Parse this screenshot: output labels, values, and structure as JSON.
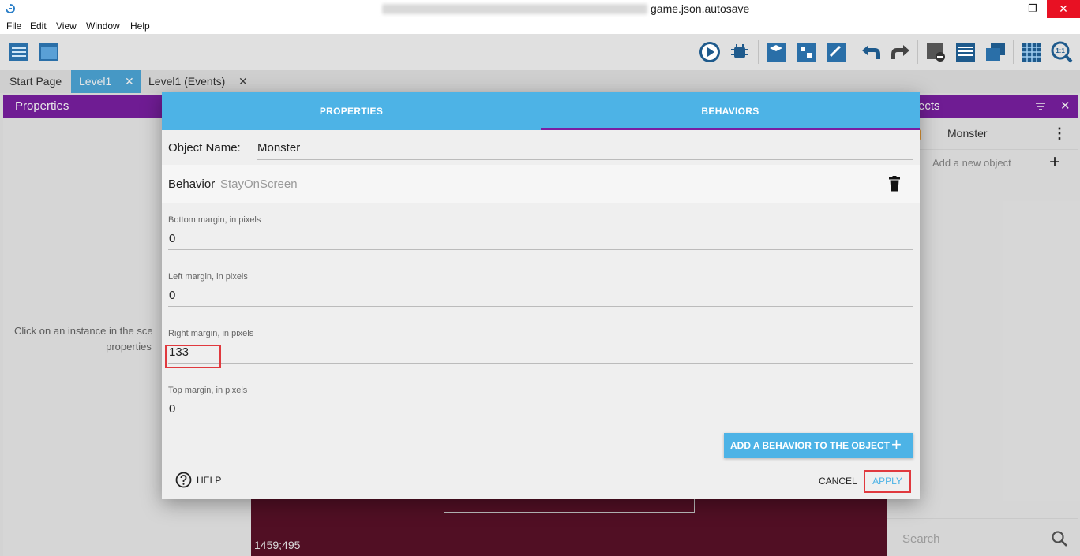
{
  "window": {
    "title": "game.json.autosave",
    "minimize": "—",
    "maximize": "❐",
    "close": "✕"
  },
  "menu": [
    "File",
    "Edit",
    "View",
    "Window",
    "Help"
  ],
  "tabs": [
    {
      "label": "Start Page",
      "active": false,
      "closable": false
    },
    {
      "label": "Level1",
      "active": true,
      "closable": true
    },
    {
      "label": "Level1 (Events)",
      "active": false,
      "closable": true
    }
  ],
  "tab_close_glyph": "✕",
  "properties_panel": {
    "title": "Properties",
    "hint_line1": "Click on an instance in the sce",
    "hint_line2": "properties"
  },
  "scene": {
    "coordinates": "1459;495"
  },
  "objects_panel": {
    "title": "ects",
    "close": "✕",
    "objects": [
      {
        "name": "Monster",
        "menu": "⋮"
      }
    ],
    "add_label": "Add a new object",
    "add_glyph": "+",
    "search_placeholder": "Search"
  },
  "dialog": {
    "tabs": {
      "properties": "PROPERTIES",
      "behaviors": "BEHAVIORS",
      "active": "behaviors"
    },
    "object_name_label": "Object Name:",
    "object_name_value": "Monster",
    "behavior_label": "Behavior",
    "behavior_name": "StayOnScreen",
    "fields": [
      {
        "label": "Bottom margin, in pixels",
        "value": "0"
      },
      {
        "label": "Left margin, in pixels",
        "value": "0"
      },
      {
        "label": "Right margin, in pixels",
        "value": "133"
      },
      {
        "label": "Top margin, in pixels",
        "value": "0"
      }
    ],
    "add_behavior_label": "ADD A BEHAVIOR TO THE OBJECT",
    "add_behavior_glyph": "+",
    "help_label": "HELP",
    "cancel_label": "CANCEL",
    "apply_label": "APPLY"
  },
  "colors": {
    "accent_blue": "#4db3e6",
    "panel_purple": "#7b1fa2",
    "scene_bg": "#5a1128",
    "highlight_red": "#e0393e"
  }
}
